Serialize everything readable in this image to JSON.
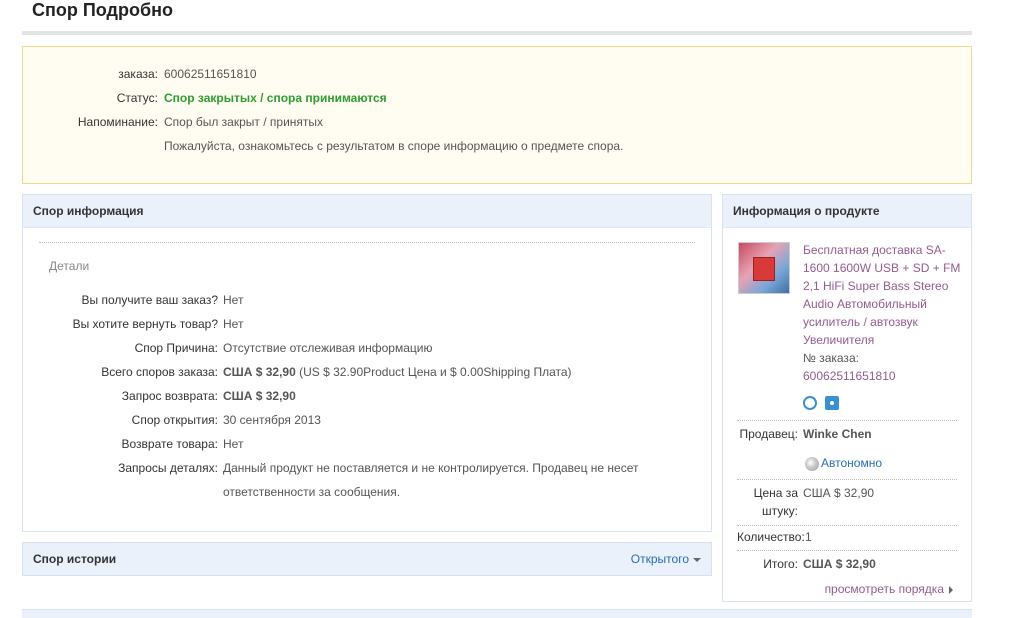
{
  "page": {
    "title": "Спор Подробно"
  },
  "notice": {
    "order_label": "заказа:",
    "order_value": "60062511651810",
    "status_label": "Статус:",
    "status_value": "Спор закрытых / спора принимаются",
    "reminder_label": "Напоминание:",
    "reminder_value": "Спор был закрыт / принятых",
    "reminder_note": "Пожалуйста, ознакомьтесь с результатом в споре информацию о предмете спора.",
    "status_color": "#2e9c2e"
  },
  "dispute_info": {
    "header": "Спор информация",
    "section": "Детали",
    "rows": [
      {
        "label": "Вы получите ваш заказ?",
        "value": "Нет"
      },
      {
        "label": "Вы хотите вернуть товар?",
        "value": "Нет"
      },
      {
        "label": "Спор Причина:",
        "value": "Отсутствие отслеживая информацию"
      },
      {
        "label": "Всего споров заказа:",
        "value_bold": "США $ 32,90",
        "value_rest": " (US $ 32.90Product Цена и $ 0.00Shipping Плата)"
      },
      {
        "label": "Запрос возврата:",
        "value": "США $ 32,90"
      },
      {
        "label": "Спор открытия:",
        "value": "30 сентября 2013"
      },
      {
        "label": "Возврате товара:",
        "value": "Нет"
      },
      {
        "label": "Запросы деталях:",
        "value_line1": "Данный продукт не поставляется и не контролируется. Продавец не несет",
        "value_line2": "ответственности за сообщения."
      }
    ],
    "refund_color": "#e8661f"
  },
  "history": {
    "header": "Спор истории",
    "toggle": "Открытого"
  },
  "product": {
    "header": "Информация о продукте",
    "title": "Бесплатная доставка SA-1600 1600W USB + SD + FM 2,1 HiFi Super Bass Stereo Audio Автомобильный усилитель / автозвук Увеличителя",
    "order_no_label": "№ заказа:",
    "order_no": "60062511651810",
    "icons": [
      "alarm-clock-icon",
      "snapshot-icon"
    ],
    "seller_label": "Продавец:",
    "seller": "Winke Chen",
    "online": "Автономно",
    "unit_price_label": "Цена за штуку:",
    "unit_price": "США $ 32,90",
    "qty_label": "Количество:",
    "qty": "1",
    "total_label": "Итого:",
    "total": "США $ 32,90",
    "view_order": "просмотреть порядка"
  }
}
